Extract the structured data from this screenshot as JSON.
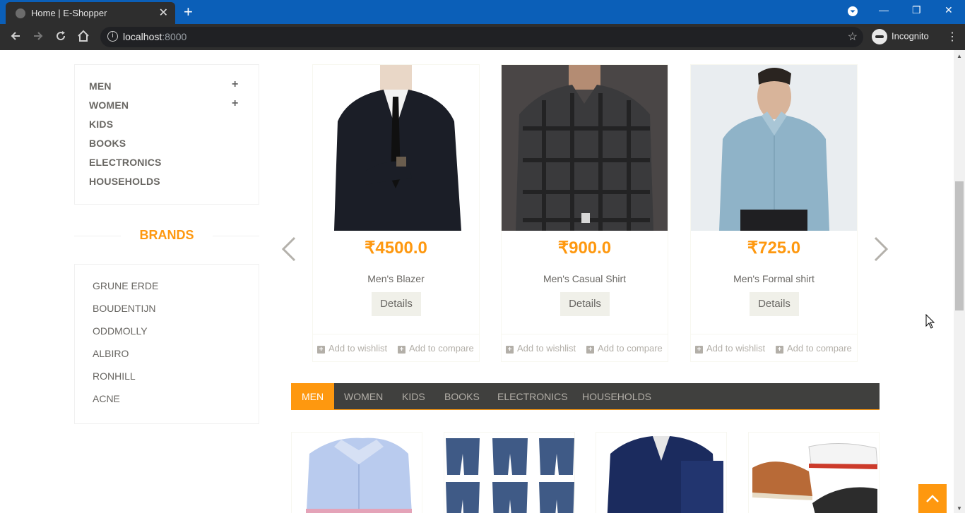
{
  "browser": {
    "tab_title": "Home | E-Shopper",
    "url_host": "localhost",
    "url_port": ":8000",
    "profile": "Incognito"
  },
  "categories": [
    {
      "label": "MEN",
      "expandable": true
    },
    {
      "label": "WOMEN",
      "expandable": true
    },
    {
      "label": "KIDS",
      "expandable": false
    },
    {
      "label": "BOOKS",
      "expandable": false
    },
    {
      "label": "ELECTRONICS",
      "expandable": false
    },
    {
      "label": "HOUSEHOLDS",
      "expandable": false
    }
  ],
  "brands": {
    "title": "BRANDS",
    "items": [
      "GRUNE ERDE",
      "BOUDENTIJN",
      "ODDMOLLY",
      "ALBIRO",
      "RONHILL",
      "ACNE"
    ]
  },
  "products": [
    {
      "price": "₹4500.0",
      "name": "Men's Blazer",
      "details": "Details",
      "wishlist": "Add to wishlist",
      "compare": "Add to compare"
    },
    {
      "price": "₹900.0",
      "name": "Men's Casual Shirt",
      "details": "Details",
      "wishlist": "Add to wishlist",
      "compare": "Add to compare"
    },
    {
      "price": "₹725.0",
      "name": "Men's Formal shirt",
      "details": "Details",
      "wishlist": "Add to wishlist",
      "compare": "Add to compare"
    }
  ],
  "category_tabs": [
    "MEN",
    "WOMEN",
    "KIDS",
    "BOOKS",
    "ELECTRONICS",
    "HOUSEHOLDS"
  ],
  "active_tab": "MEN",
  "colors": {
    "accent": "#fe980f",
    "tab_bar": "#40403e",
    "chrome": "#0b5fb8"
  }
}
